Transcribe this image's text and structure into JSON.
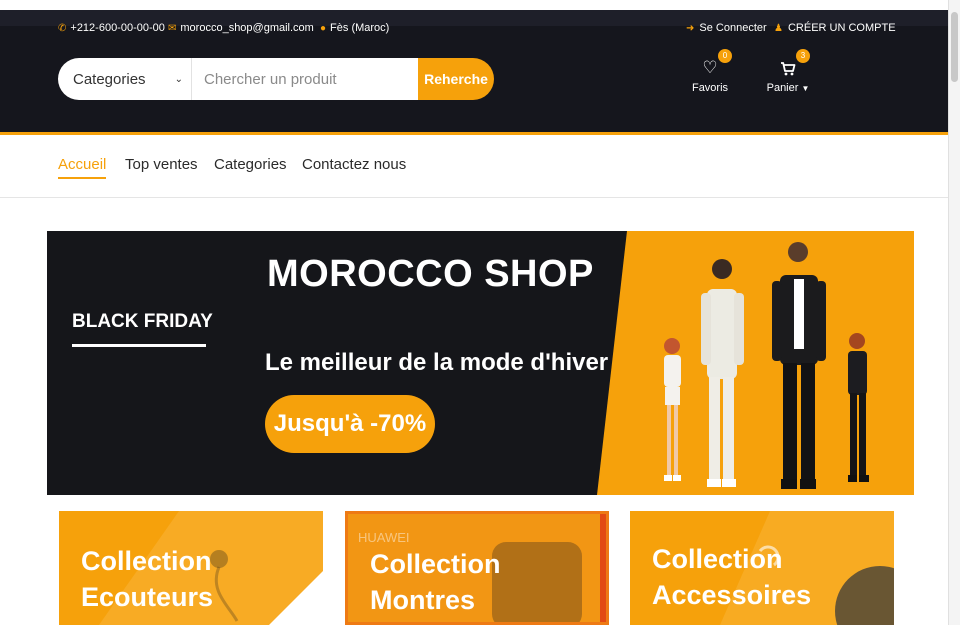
{
  "header": {
    "phone": "+212-600-00-00-00",
    "email": "morocco_shop@gmail.com",
    "location": "Fès (Maroc)",
    "login": "Se Connecter",
    "register": "CRÉER UN COMPTE"
  },
  "search": {
    "category": "Categories",
    "placeholder": "Chercher un produit",
    "button": "Reherche"
  },
  "wishlist": {
    "label": "Favoris",
    "count": "0"
  },
  "cart": {
    "label": "Panier",
    "count": "3"
  },
  "nav": [
    {
      "label": "Accueil",
      "active": true
    },
    {
      "label": "Top ventes"
    },
    {
      "label": "Categories"
    },
    {
      "label": "Contactez nous"
    }
  ],
  "hero": {
    "title": "MOROCCO SHOP",
    "badge": "BLACK FRIDAY",
    "subtitle": "Le meilleur de la mode d'hiver",
    "promo": "Jusqu'à -70%"
  },
  "collections": [
    {
      "line1": "Collection",
      "line2": "Ecouteurs"
    },
    {
      "line1": "Collection",
      "line2": "Montres",
      "brand": "HUAWEI"
    },
    {
      "line1": "Collection",
      "line2": "Accessoires"
    }
  ],
  "colors": {
    "accent": "#f6a10b",
    "dark": "#15161d"
  }
}
